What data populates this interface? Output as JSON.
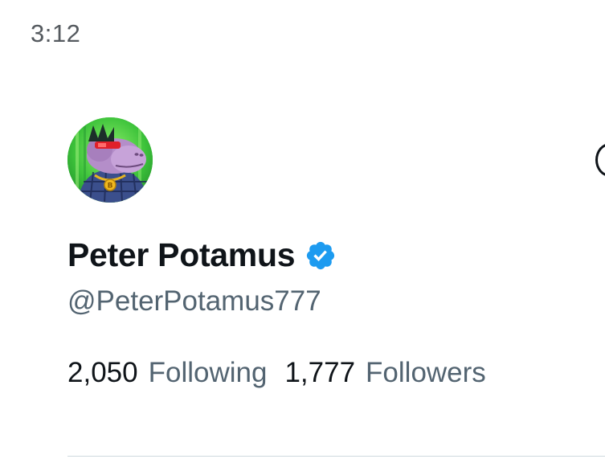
{
  "status_bar": {
    "time": "3:12"
  },
  "profile": {
    "display_name": "Peter Potamus",
    "handle": "@PeterPotamus777",
    "verified": true,
    "avatar_icon": "hippo-avatar",
    "stats": {
      "following_count": "2,050",
      "following_label": "Following",
      "followers_count": "1,777",
      "followers_label": "Followers"
    }
  },
  "colors": {
    "text_primary": "#0f1419",
    "text_secondary": "#536471",
    "verified_blue": "#1d9bf0",
    "status_time": "#555a5f"
  }
}
